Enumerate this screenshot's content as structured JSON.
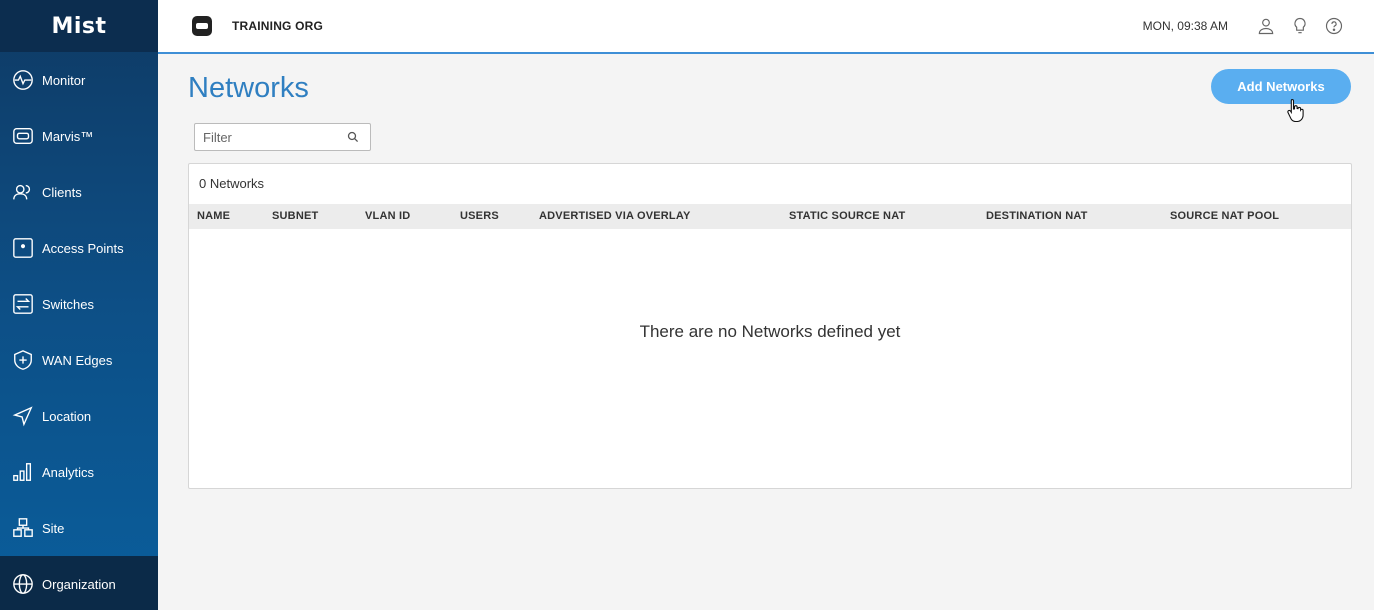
{
  "app": {
    "logo_text": "Mist"
  },
  "sidebar": {
    "items": [
      {
        "label": "Monitor",
        "icon": "monitor-icon"
      },
      {
        "label": "Marvis™",
        "icon": "marvis-icon"
      },
      {
        "label": "Clients",
        "icon": "clients-icon"
      },
      {
        "label": "Access Points",
        "icon": "access-point-icon"
      },
      {
        "label": "Switches",
        "icon": "switch-icon"
      },
      {
        "label": "WAN Edges",
        "icon": "wan-edge-icon"
      },
      {
        "label": "Location",
        "icon": "location-icon"
      },
      {
        "label": "Analytics",
        "icon": "analytics-icon"
      },
      {
        "label": "Site",
        "icon": "site-icon"
      },
      {
        "label": "Organization",
        "icon": "organization-icon",
        "selected": true
      }
    ]
  },
  "header": {
    "org_name": "TRAINING ORG",
    "clock": "MON, 09:38 AM",
    "icons": [
      "user-icon",
      "lightbulb-icon",
      "help-icon"
    ]
  },
  "main": {
    "title": "Networks",
    "add_button": "Add Networks",
    "filter_placeholder": "Filter",
    "count_label": "0 Networks",
    "columns": [
      "NAME",
      "SUBNET",
      "VLAN ID",
      "USERS",
      "ADVERTISED VIA OVERLAY",
      "STATIC SOURCE NAT",
      "DESTINATION NAT",
      "SOURCE NAT POOL"
    ],
    "empty_message": "There are no Networks defined yet"
  },
  "colors": {
    "accent": "#2f7fc1",
    "button": "#5aaef0",
    "sidebar_top": "#0f3a64",
    "sidebar_bottom": "#0a5e9c"
  }
}
